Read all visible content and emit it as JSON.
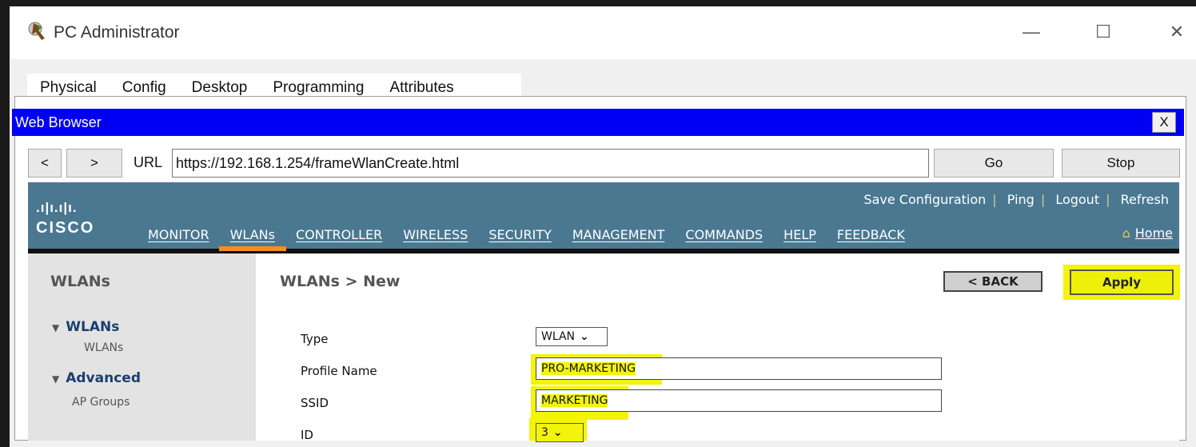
{
  "window": {
    "title": "PC Administrator",
    "controls": {
      "minimize": "—",
      "maximize": "☐",
      "close": "✕"
    }
  },
  "tabs": [
    {
      "label": "Physical"
    },
    {
      "label": "Config"
    },
    {
      "label": "Desktop",
      "active": true
    },
    {
      "label": "Programming"
    },
    {
      "label": "Attributes"
    }
  ],
  "browser": {
    "title": "Web Browser",
    "close_label": "X",
    "back_label": "<",
    "forward_label": ">",
    "url_label": "URL",
    "url": "https://192.168.1.254/frameWlanCreate.html",
    "go_label": "Go",
    "stop_label": "Stop"
  },
  "cisco": {
    "logo_bars": ".ı|ı.ı|ı.",
    "logo_word": "CISCO",
    "toplinks": [
      "Save Configuration",
      "Ping",
      "Logout",
      "Refresh"
    ],
    "menu": [
      "MONITOR",
      "WLANs",
      "CONTROLLER",
      "WIRELESS",
      "SECURITY",
      "MANAGEMENT",
      "COMMANDS",
      "HELP",
      "FEEDBACK"
    ],
    "active_menu": "WLANs",
    "home_label": "Home",
    "accent_color": "#f58e1e",
    "header_color": "#4a7891"
  },
  "sidebar": {
    "title": "WLANs",
    "groups": [
      {
        "label": "WLANs",
        "items": [
          "WLANs"
        ]
      },
      {
        "label": "Advanced",
        "items": [
          "AP Groups"
        ]
      }
    ]
  },
  "main": {
    "page_title": "WLANs > New",
    "back_label": "< BACK",
    "apply_label": "Apply",
    "fields": {
      "type_label": "Type",
      "type_value": "WLAN",
      "profile_label": "Profile Name",
      "profile_value": "PRO-MARKETING",
      "ssid_label": "SSID",
      "ssid_value": "MARKETING",
      "id_label": "ID",
      "id_value": "3"
    },
    "highlight_color": "#f3f30c"
  }
}
